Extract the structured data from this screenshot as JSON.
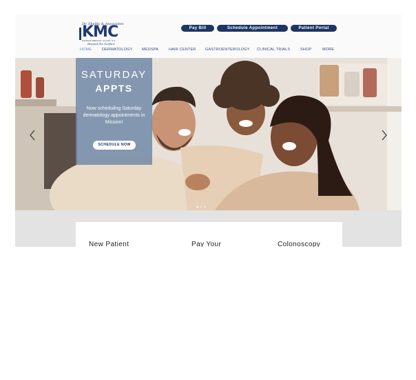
{
  "logo": {
    "script_text": "Dr. Shelby & Associates",
    "mark": "KMC",
    "subtitle": "KANSAS MEDICAL CLINIC, P.A.",
    "tagline": "Beyond the Surface"
  },
  "header": {
    "buttons": [
      "Pay Bill",
      "Schedule Appointment",
      "Patient Portal"
    ]
  },
  "nav": {
    "items": [
      "HOME",
      "DERMATOLOGY",
      "MEDSPA",
      "HAIR CENTER",
      "GASTROENTEROLOGY",
      "CLINICAL TRIALS",
      "SHOP",
      "MORE"
    ],
    "active": "HOME"
  },
  "hero": {
    "heading_line1": "SATURDAY",
    "heading_line2": "APPTS",
    "body": "Now scheduling Saturday dermatology appointments in Mission!",
    "cta": "SCHEDULE NOW",
    "slide_count": 3,
    "active_slide": 1
  },
  "cards": {
    "items": [
      "New Patient",
      "Pay Your",
      "Colonoscopy"
    ]
  },
  "colors": {
    "brand_navy": "#1c3564",
    "nav_link": "#2a4a86",
    "nav_active": "#5b8ad0",
    "promo_overlay": "#6c86a6"
  }
}
